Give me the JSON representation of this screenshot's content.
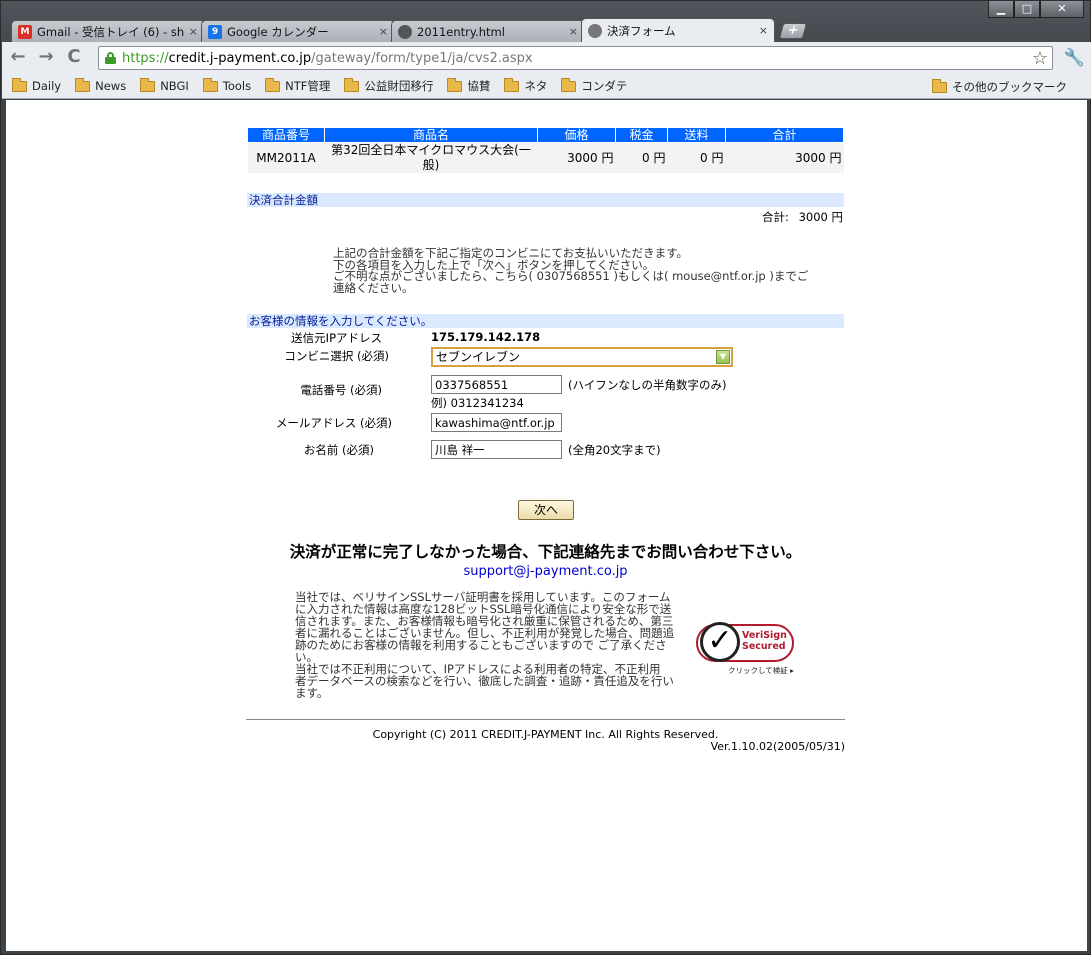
{
  "window": {
    "minimize": "▁",
    "maximize": "□",
    "close": "✕"
  },
  "tabs": [
    {
      "label": "Gmail - 受信トレイ (6) - sho",
      "favicon": "gmail-icon",
      "color": "#d93025",
      "glyph": "M"
    },
    {
      "label": "Google カレンダー",
      "favicon": "calendar-icon",
      "color": "#1a73e8",
      "glyph": "9"
    },
    {
      "label": "2011entry.html",
      "favicon": "globe-icon",
      "color": "#555555",
      "glyph": ""
    },
    {
      "label": "決済フォーム",
      "favicon": "globe-icon",
      "color": "#777777",
      "glyph": ""
    }
  ],
  "tab_close": "×",
  "new_tab": "+",
  "toolbar": {
    "back": "←",
    "forward": "→",
    "reload": "C",
    "url_scheme": "https://",
    "url_host": "credit.j-payment.co.jp",
    "url_path": "/gateway/form/type1/ja/cvs2.aspx",
    "star": "☆",
    "wrench": "🔧"
  },
  "bookmarks": [
    "Daily",
    "News",
    "NBGI",
    "Tools",
    "NTF管理",
    "公益財団移行",
    "協賛",
    "ネタ",
    "コンダテ"
  ],
  "bookmarks_other": "その他のブックマーク",
  "order": {
    "headers": [
      "商品番号",
      "商品名",
      "価格",
      "税金",
      "送料",
      "合計"
    ],
    "row": [
      "MM2011A",
      "第32回全日本マイクロマウス大会(一般)",
      "3000 円",
      "0 円",
      "0 円",
      "3000 円"
    ]
  },
  "payment_total": {
    "heading": "決済合計金額",
    "label": "合計:",
    "value": "3000 円"
  },
  "instructions": [
    "上記の合計金額を下記ご指定のコンビニにてお支払いいただきます。",
    "下の各項目を入力した上で「次へ」ボタンを押してください。",
    "ご不明な点がございましたら、こちら( 0307568551 )もしくは( mouse@ntf.or.jp )までご",
    "連絡ください。"
  ],
  "customer": {
    "heading": "お客様の情報を入力してください。",
    "ip_label": "送信元IPアドレス",
    "ip_value": "175.179.142.178",
    "store_label": "コンビニ選択 (必須)",
    "store_value": "セブンイレブン",
    "store_arrow": "▼",
    "phone_label": "電話番号 (必須)",
    "phone_value": "0337568551",
    "phone_hint": "(ハイフンなしの半角数字のみ)",
    "phone_example": "例) 0312341234",
    "email_label": "メールアドレス (必須)",
    "email_value": "kawashima@ntf.or.jp",
    "name_label": "お名前 (必須)",
    "name_value": "川島 祥一",
    "name_hint": "(全角20文字まで)"
  },
  "next_button": "次へ",
  "warning": "決済が正常に完了しなかった場合、下記連絡先までお問い合わせ下さい。",
  "support_email": "support@j-payment.co.jp",
  "security_text": [
    "当社では、ベリサインSSLサーバ証明書を採用しています。このフォーム",
    "に入力された情報は高度な128ビットSSL暗号化通信により安全な形で送",
    "信されます。また、お客様情報も暗号化され厳重に保管されるため、第三",
    "者に漏れることはございません。但し、不正利用が発覚した場合、問題追",
    "跡のためにお客様の情報を利用することもございますので ご了承くださ",
    "い。",
    "当社では不正利用について、IPアドレスによる利用者の特定、不正利用",
    "者データベースの検索などを行い、徹底した調査・追跡・責任追及を行い",
    "ます。"
  ],
  "verisign": {
    "line1": "VeriSign",
    "line2": "Secured",
    "line3": "クリックして検証 ▸",
    "check": "✓"
  },
  "copyright": "Copyright (C) 2011 CREDIT.J-PAYMENT Inc. All Rights Reserved.",
  "version": "Ver.1.10.02(2005/05/31)"
}
